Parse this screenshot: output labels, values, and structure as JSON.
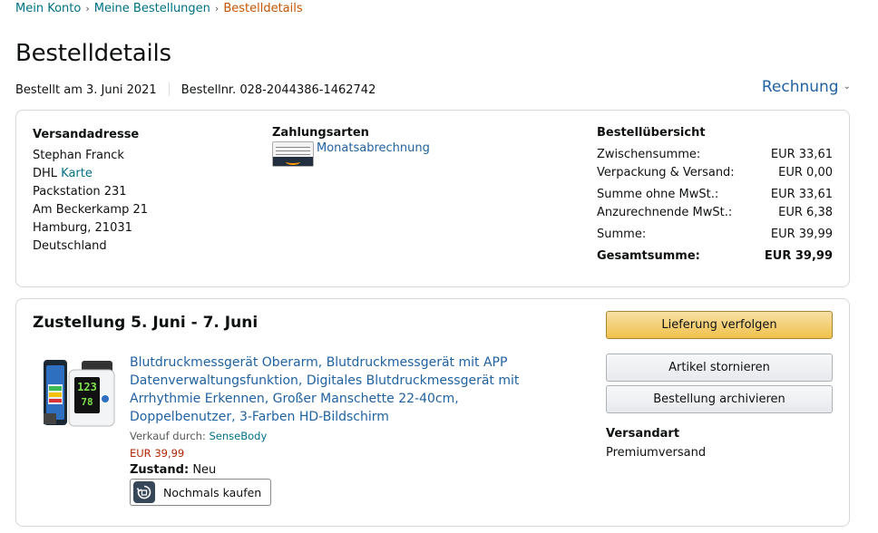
{
  "breadcrumb": {
    "items": [
      "Mein Konto",
      "Meine Bestellungen"
    ],
    "current": "Bestelldetails",
    "separator": "›"
  },
  "page_title": "Bestelldetails",
  "order_meta": {
    "ordered_on": "Bestellt am 3. Juni 2021",
    "order_number": "Bestellnr. 028-2044386-1462742"
  },
  "invoice": {
    "label": "Rechnung",
    "icon": "chevron-down-icon"
  },
  "shipping_address": {
    "title": "Versandadresse",
    "name": "Stephan Franck",
    "carrier_prefix": "DHL",
    "carrier_link": "Karte",
    "line1": "Packstation 231",
    "line2": "Am Beckerkamp 21",
    "city": "Hamburg, 21031",
    "country": "Deutschland"
  },
  "payment": {
    "title": "Zahlungsarten",
    "method": "Monatsabrechnung",
    "icon": "payment-card-icon"
  },
  "summary": {
    "title": "Bestellübersicht",
    "rows": [
      {
        "label": "Zwischensumme:",
        "value": "EUR 33,61"
      },
      {
        "label": "Verpackung & Versand:",
        "value": "EUR 0,00"
      },
      {
        "label": "Summe ohne MwSt.:",
        "value": "EUR 33,61"
      },
      {
        "label": "Anzurechnende MwSt.:",
        "value": "EUR 6,38"
      },
      {
        "label": "Summe:",
        "value": "EUR 39,99"
      },
      {
        "label": "Gesamtsumme:",
        "value": "EUR 39,99"
      }
    ]
  },
  "delivery": {
    "title": "Zustellung 5. Juni - 7. Juni",
    "product": {
      "title": "Blutdruckmessgerät Oberarm, Blutdruckmessgerät mit APP Datenverwaltungsfunktion, Digitales Blutdruckmessgerät mit Arrhythmie Erkennen, Großer Manschette 22-40cm, Doppelbenutzer, 3-Farben HD-Bildschirm",
      "seller_prefix": "Verkauf durch:",
      "seller": "SenseBody",
      "price": "EUR 39,99",
      "condition_label": "Zustand:",
      "condition": "Neu",
      "display_reading": "123",
      "display_reading2": "78",
      "rebuy_label": "Nochmals kaufen",
      "rebuy_icon": "rebuy-icon"
    },
    "actions": {
      "track": "Lieferung verfolgen",
      "cancel": "Artikel stornieren",
      "archive": "Bestellung archivieren"
    },
    "shipping_type_title": "Versandart",
    "shipping_type": "Premiumversand"
  },
  "colors": {
    "link": "#007185",
    "link_dark": "#2162a1",
    "breadcrumb_current": "#c45500",
    "price": "#b12704",
    "primary_button": "#f0c14b"
  }
}
